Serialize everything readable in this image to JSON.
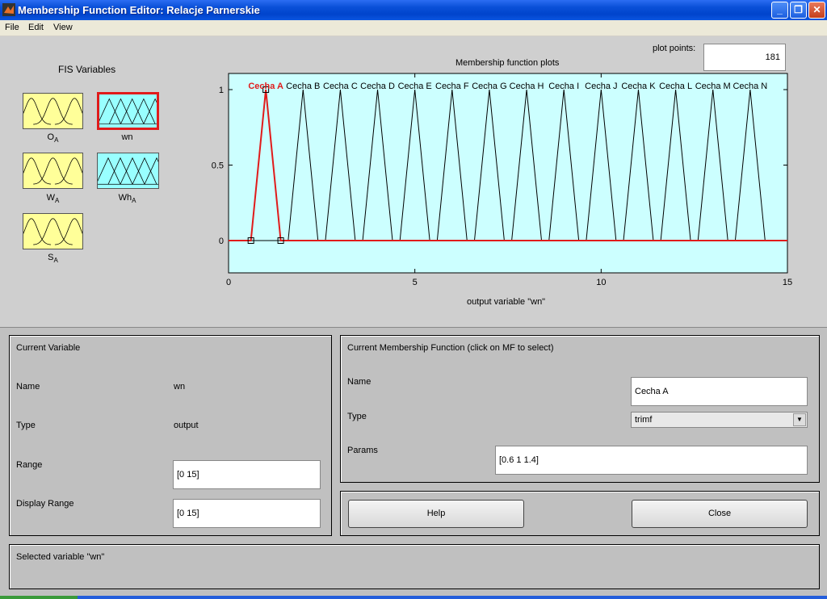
{
  "window": {
    "title": "Membership Function Editor: Relacje Parnerskie",
    "buttons": {
      "minimize": "_",
      "maximize": "❐",
      "close": "✕"
    }
  },
  "menu": {
    "file": "File",
    "edit": "Edit",
    "view": "View"
  },
  "fis": {
    "title": "FIS Variables",
    "variables": [
      {
        "name": "O",
        "sub": "A",
        "kind": "input",
        "color": "#ffff99"
      },
      {
        "name": "wn",
        "sub": "",
        "kind": "output",
        "color": "#99ffff",
        "selected": true
      },
      {
        "name": "W",
        "sub": "A",
        "kind": "input",
        "color": "#ffff99"
      },
      {
        "name": "Wh",
        "sub": "A",
        "kind": "output",
        "color": "#99ffff"
      },
      {
        "name": "S",
        "sub": "A",
        "kind": "input",
        "color": "#ffff99"
      }
    ]
  },
  "plot": {
    "title": "Membership function plots",
    "plot_points_label": "plot points:",
    "plot_points_value": "181",
    "xlabel": "output variable \"wn\"",
    "bg_color": "#ccffff",
    "selected_color": "#e01b1b"
  },
  "chart_data": {
    "type": "line",
    "xlim": [
      0,
      15
    ],
    "ylim": [
      0,
      1
    ],
    "xticks": [
      "0",
      "5",
      "10",
      "15"
    ],
    "yticks": [
      "0",
      "0.5",
      "1"
    ],
    "selected_index": 0,
    "series": [
      {
        "name": "Cecha A",
        "params": [
          0.6,
          1,
          1.4
        ]
      },
      {
        "name": "Cecha B",
        "params": [
          1.6,
          2,
          2.4
        ]
      },
      {
        "name": "Cecha C",
        "params": [
          2.6,
          3,
          3.4
        ]
      },
      {
        "name": "Cecha D",
        "params": [
          3.6,
          4,
          4.4
        ]
      },
      {
        "name": "Cecha E",
        "params": [
          4.6,
          5,
          5.4
        ]
      },
      {
        "name": "Cecha F",
        "params": [
          5.6,
          6,
          6.4
        ]
      },
      {
        "name": "Cecha G",
        "params": [
          6.6,
          7,
          7.4
        ]
      },
      {
        "name": "Cecha H",
        "params": [
          7.6,
          8,
          8.4
        ]
      },
      {
        "name": "Cecha I",
        "params": [
          8.6,
          9,
          9.4
        ]
      },
      {
        "name": "Cecha J",
        "params": [
          9.6,
          10,
          10.4
        ]
      },
      {
        "name": "Cecha K",
        "params": [
          10.6,
          11,
          11.4
        ]
      },
      {
        "name": "Cecha L",
        "params": [
          11.6,
          12,
          12.4
        ]
      },
      {
        "name": "Cecha M",
        "params": [
          12.6,
          13,
          13.4
        ]
      },
      {
        "name": "Cecha N",
        "params": [
          13.6,
          14,
          14.4
        ]
      }
    ]
  },
  "current_variable": {
    "title": "Current Variable",
    "name_label": "Name",
    "name_value": "wn",
    "type_label": "Type",
    "type_value": "output",
    "range_label": "Range",
    "range_value": "[0 15]",
    "display_range_label": "Display Range",
    "display_range_value": "[0 15]"
  },
  "current_mf": {
    "title": "Current Membership Function (click on MF to select)",
    "name_label": "Name",
    "name_value": "Cecha A",
    "type_label": "Type",
    "type_value": "trimf",
    "params_label": "Params",
    "params_value": "[0.6 1 1.4]"
  },
  "actions": {
    "help": "Help",
    "close": "Close"
  },
  "status": "Selected variable \"wn\""
}
